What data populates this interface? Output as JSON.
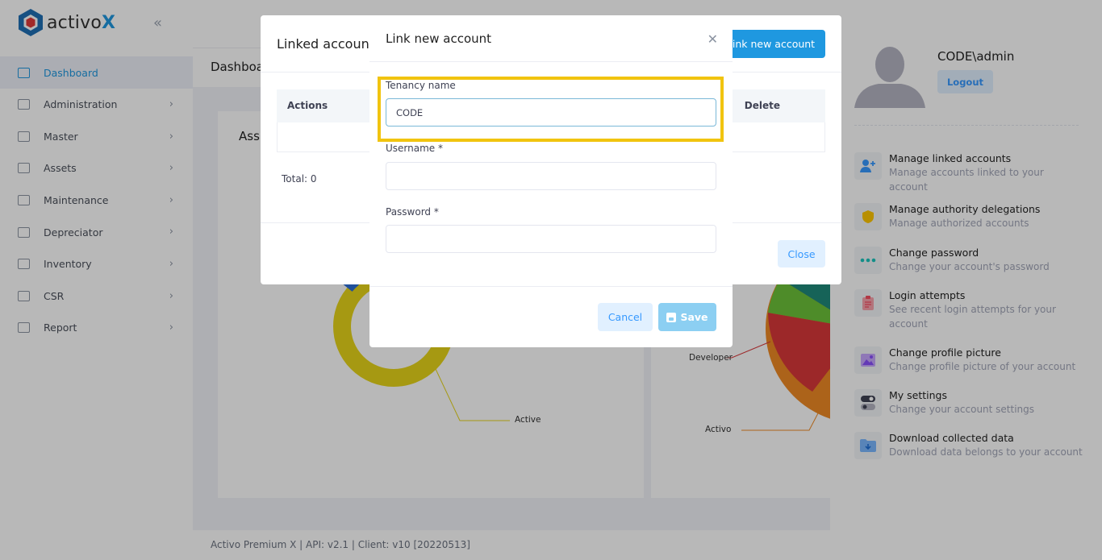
{
  "brand": {
    "name_prefix": "activo",
    "name_suffix": "X"
  },
  "sidebar": {
    "collapse_icon": "double-chevron-left",
    "items": [
      {
        "label": "Dashboard",
        "icon": "dashboard-icon",
        "active": true
      },
      {
        "label": "Administration",
        "icon": "admin-icon"
      },
      {
        "label": "Master",
        "icon": "layers-icon"
      },
      {
        "label": "Assets",
        "icon": "assets-icon"
      },
      {
        "label": "Maintenance",
        "icon": "gear-icon"
      },
      {
        "label": "Depreciator",
        "icon": "depreciator-icon"
      },
      {
        "label": "Inventory",
        "icon": "inventory-icon"
      },
      {
        "label": "CSR",
        "icon": "csr-icon"
      },
      {
        "label": "Report",
        "icon": "report-icon"
      }
    ]
  },
  "subheader": {
    "title": "Dashboa"
  },
  "card1": {
    "title": "Ass"
  },
  "charts": {
    "label_active": "Active",
    "label_developer": "Developer",
    "label_activo": "Activo"
  },
  "footer": {
    "text": "Activo Premium X | API: v2.1 | Client: v10 [20220513]"
  },
  "linked_modal": {
    "title": "Linked account",
    "link_button": "Link new account",
    "columns": {
      "actions": "Actions",
      "delete": "Delete"
    },
    "total": "Total: 0",
    "close_button": "Close"
  },
  "user_panel": {
    "username": "CODE\\admin",
    "logout": "Logout",
    "items": [
      {
        "title": "Manage linked accounts",
        "desc": "Manage accounts linked to your account",
        "icon": "add-user-icon",
        "color": "#3699ff"
      },
      {
        "title": "Manage authority delegations",
        "desc": "Manage authorized accounts",
        "icon": "shield-icon",
        "color": "#ffc700"
      },
      {
        "title": "Change password",
        "desc": "Change your account's password",
        "icon": "dots-icon",
        "color": "#1bc5bd"
      },
      {
        "title": "Login attempts",
        "desc": "See recent login attempts for your account",
        "icon": "clipboard-icon",
        "color": "#f64e60"
      },
      {
        "title": "Change profile picture",
        "desc": "Change profile picture of your account",
        "icon": "image-icon",
        "color": "#8950fc"
      },
      {
        "title": "My settings",
        "desc": "Change your account settings",
        "icon": "toggle-icon",
        "color": "#3f4254"
      },
      {
        "title": "Download collected data",
        "desc": "Download data belongs to your account",
        "icon": "folder-download-icon",
        "color": "#3699ff"
      }
    ]
  },
  "new_modal": {
    "title": "Link new account",
    "tenancy_label": "Tenancy name",
    "tenancy_value": "CODE",
    "username_label": "Username *",
    "password_label": "Password *",
    "cancel": "Cancel",
    "save": "Save"
  },
  "colors": {
    "accent": "#1f98e0",
    "highlight": "#f1c40f",
    "light_accent": "#e1f0ff"
  }
}
